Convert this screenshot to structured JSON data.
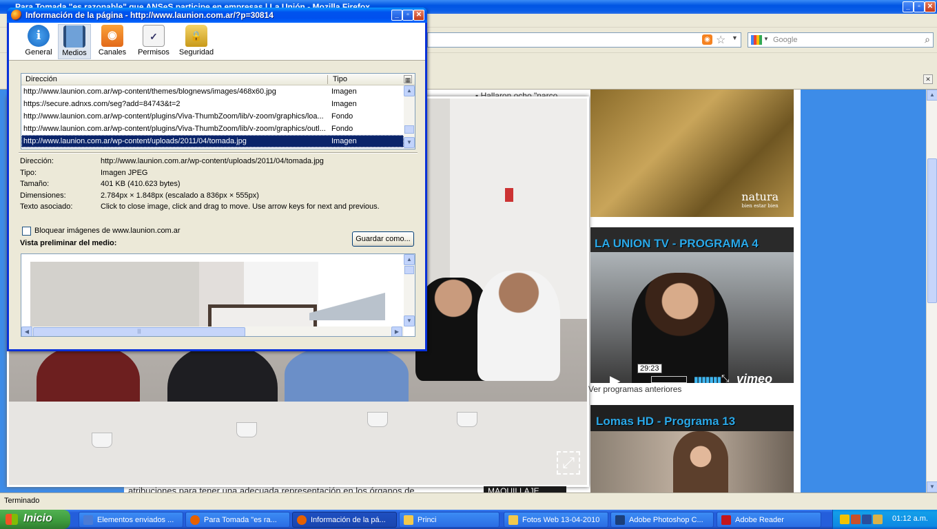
{
  "browser": {
    "title": "Para Tomada \"es razonable\" que ANSeS participe en empresas | La Unión - Mozilla Firefox",
    "search_placeholder": "Google",
    "status": "Terminado"
  },
  "page": {
    "bullet_text": "Hallaron ocho \"narco",
    "article_bottom_text": "atribuciones para tener una adecuada representación en los órganos de",
    "ad_label": "MAQUILLAJE",
    "natura_logo": "natura",
    "natura_sub": "bien estar bien",
    "tv_title": "LA UNION TV - PROGRAMA 4",
    "tv_time": "29:23",
    "vimeo": "vimeo",
    "tv_more": "Ver programas anteriores",
    "lomas_title": "Lomas HD - Programa 13"
  },
  "dialog": {
    "title": "Información de la página - http://www.launion.com.ar/?p=30814",
    "tabs": [
      {
        "label": "General",
        "icon": "info-icon",
        "glyph": "i"
      },
      {
        "label": "Medios",
        "icon": "media-icon",
        "glyph": ""
      },
      {
        "label": "Canales",
        "icon": "feed-icon",
        "glyph": "◉"
      },
      {
        "label": "Permisos",
        "icon": "permissions-icon",
        "glyph": "✓"
      },
      {
        "label": "Seguridad",
        "icon": "lock-icon",
        "glyph": "🔒"
      }
    ],
    "columns": {
      "address": "Dirección",
      "type": "Tipo"
    },
    "media_rows": [
      {
        "url": "http://www.launion.com.ar/wp-content/themes/blognews/images/468x60.jpg",
        "type": "Imagen"
      },
      {
        "url": "https://secure.adnxs.com/seg?add=84743&t=2",
        "type": "Imagen"
      },
      {
        "url": "http://www.launion.com.ar/wp-content/plugins/Viva-ThumbZoom/lib/v-zoom/graphics/loa...",
        "type": "Fondo"
      },
      {
        "url": "http://www.launion.com.ar/wp-content/plugins/Viva-ThumbZoom/lib/v-zoom/graphics/outl...",
        "type": "Fondo"
      },
      {
        "url": "http://www.launion.com.ar/wp-content/uploads/2011/04/tomada.jpg",
        "type": "Imagen"
      }
    ],
    "properties": [
      {
        "label": "Dirección:",
        "value": "http://www.launion.com.ar/wp-content/uploads/2011/04/tomada.jpg"
      },
      {
        "label": "Tipo:",
        "value": "Imagen JPEG"
      },
      {
        "label": "Tamaño:",
        "value": "401 KB (410.623 bytes)"
      },
      {
        "label": "Dimensiones:",
        "value": "2.784px × 1.848px (escalado a 836px × 555px)"
      },
      {
        "label": "Texto asociado:",
        "value": "Click to close image, click and drag to move. Use arrow keys for next and previous."
      }
    ],
    "block_label": "Bloquear imágenes de www.launion.com.ar",
    "preview_label": "Vista preliminar del medio:",
    "save_button": "Guardar como..."
  },
  "taskbar": {
    "start": "Inicio",
    "tasks": [
      {
        "label": "Elementos enviados ...",
        "color": "#4a7bd6"
      },
      {
        "label": "Para Tomada \"es ra...",
        "color": "#e66000"
      },
      {
        "label": "Información de la pá...",
        "color": "#e66000"
      },
      {
        "label": "Princi",
        "color": "#f2c94c"
      },
      {
        "label": "Fotos Web 13-04-2010",
        "color": "#f2c94c"
      },
      {
        "label": "Adobe Photoshop C...",
        "color": "#1b3f7a"
      },
      {
        "label": "Adobe Reader",
        "color": "#c4161c"
      }
    ],
    "clock": "01:12 a.m."
  }
}
